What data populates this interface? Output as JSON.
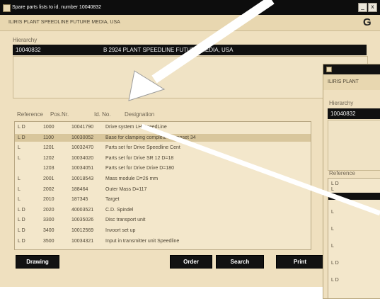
{
  "window": {
    "title": "Spare parts lists to id. number 10040832",
    "subheader": "ILIRIS PLANT  SPEEDLINE  FUTURE MEDIA, USA",
    "logo": "G",
    "minimize": "_",
    "close": "x"
  },
  "hierarchy": {
    "label": "Hierarchy",
    "id": "10040832",
    "path": "B 2924 PLANT  SPEEDLINE  FUTURE MEDIA, USA"
  },
  "table": {
    "headers": [
      "Reference",
      "Pos.Nr.",
      "Id. No.",
      "Designation"
    ],
    "rows": [
      {
        "ref": "L D",
        "pos": "1000",
        "id": "10041790",
        "des": "Drive system  LH SpeedLine",
        "selected": false
      },
      {
        "ref": "L D",
        "pos": "1100",
        "id": "10030052",
        "des": "Base for clamping complete Clampset 34",
        "selected": true
      },
      {
        "ref": "L",
        "pos": "1201",
        "id": "10032470",
        "des": "Parts set for Drive Speedline Cent",
        "selected": false
      },
      {
        "ref": "L",
        "pos": "1202",
        "id": "10034020",
        "des": "Parts set for Drive  SR 12  D=18",
        "selected": false
      },
      {
        "ref": "",
        "pos": "1203",
        "id": "10034051",
        "des": "Parts set for Drive Drive D=180",
        "selected": false
      },
      {
        "ref": "L",
        "pos": "2001",
        "id": "10018543",
        "des": "Mass module  D=26 mm",
        "selected": false
      },
      {
        "ref": "L",
        "pos": "2002",
        "id": "188464",
        "des": "Outer Mass D=117",
        "selected": false
      },
      {
        "ref": "L",
        "pos": "2010",
        "id": "187345",
        "des": "Target",
        "selected": false
      },
      {
        "ref": "L D",
        "pos": "2020",
        "id": "40003521",
        "des": "C.D. Spindel",
        "selected": false
      },
      {
        "ref": "L D",
        "pos": "3300",
        "id": "10035026",
        "des": "Disc transport unit",
        "selected": false
      },
      {
        "ref": "L D",
        "pos": "3400",
        "id": "10012569",
        "des": "Invoort set up",
        "selected": false
      },
      {
        "ref": "L D",
        "pos": "3500",
        "id": "10034321",
        "des": "Input in transmitter unit Speedline",
        "selected": false
      }
    ]
  },
  "buttons": {
    "drawing": "Drawing",
    "order": "Order",
    "search": "Search",
    "print": "Print"
  },
  "second_window": {
    "subheader": "ILIRIS PLANT",
    "hierarchy_label": "Hierarchy",
    "hierarchy_id": "10040832",
    "reference_label": "Reference",
    "rows": [
      "L D",
      "L",
      "L",
      "L",
      "L",
      "L D",
      "L D"
    ]
  }
}
